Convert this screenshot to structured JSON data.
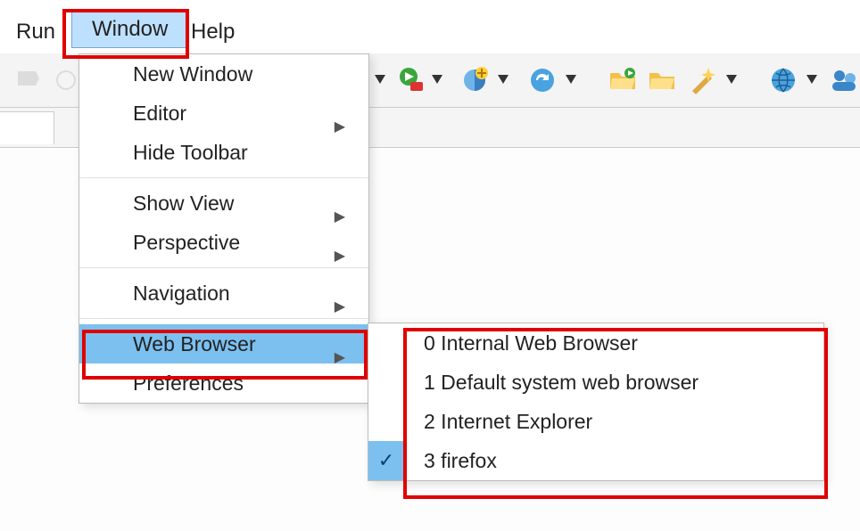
{
  "menubar": {
    "run": "Run",
    "window": "Window",
    "help": "Help"
  },
  "window_menu": {
    "new_window": "New Window",
    "editor": "Editor",
    "hide_toolbar": "Hide Toolbar",
    "show_view": "Show View",
    "perspective": "Perspective",
    "navigation": "Navigation",
    "web_browser": "Web Browser",
    "preferences": "Preferences"
  },
  "web_browser_submenu": {
    "items": [
      {
        "label": "0 Internal Web Browser",
        "checked": false
      },
      {
        "label": "1 Default system web browser",
        "checked": false
      },
      {
        "label": "2 Internet Explorer",
        "checked": false
      },
      {
        "label": "3 firefox",
        "checked": true
      }
    ]
  },
  "highlight_boxes": [
    "menubar-window",
    "web-browser-item",
    "submenu-box"
  ]
}
